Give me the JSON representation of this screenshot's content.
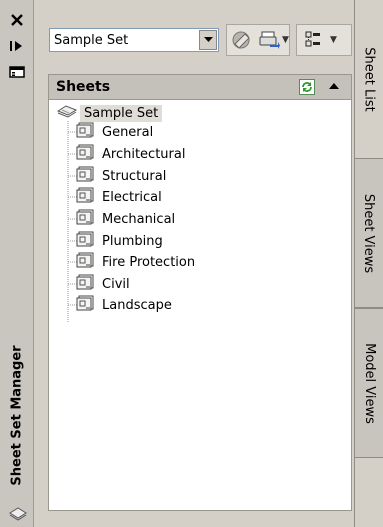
{
  "palette": {
    "title": "Sheet Set Manager",
    "close_glyph": "✕",
    "autohide_glyph": "⊢▸",
    "properties_glyph": "▤"
  },
  "toolbar": {
    "sheet_set_select": {
      "value": "Sample Set"
    }
  },
  "sheets_panel": {
    "header": "Sheets",
    "root": "Sample Set",
    "items": [
      {
        "label": "General"
      },
      {
        "label": "Architectural"
      },
      {
        "label": "Structural"
      },
      {
        "label": "Electrical"
      },
      {
        "label": "Mechanical"
      },
      {
        "label": "Plumbing"
      },
      {
        "label": "Fire Protection"
      },
      {
        "label": "Civil"
      },
      {
        "label": "Landscape"
      }
    ]
  },
  "tabs": [
    {
      "label": "Sheet List",
      "active": true
    },
    {
      "label": "Sheet Views",
      "active": false
    },
    {
      "label": "Model Views",
      "active": false
    }
  ],
  "colors": {
    "panel_bg": "#d4d0c8",
    "tree_bg": "#ffffff",
    "header_bg": "#c4c1ba",
    "refresh_green": "#2e9a2e"
  }
}
